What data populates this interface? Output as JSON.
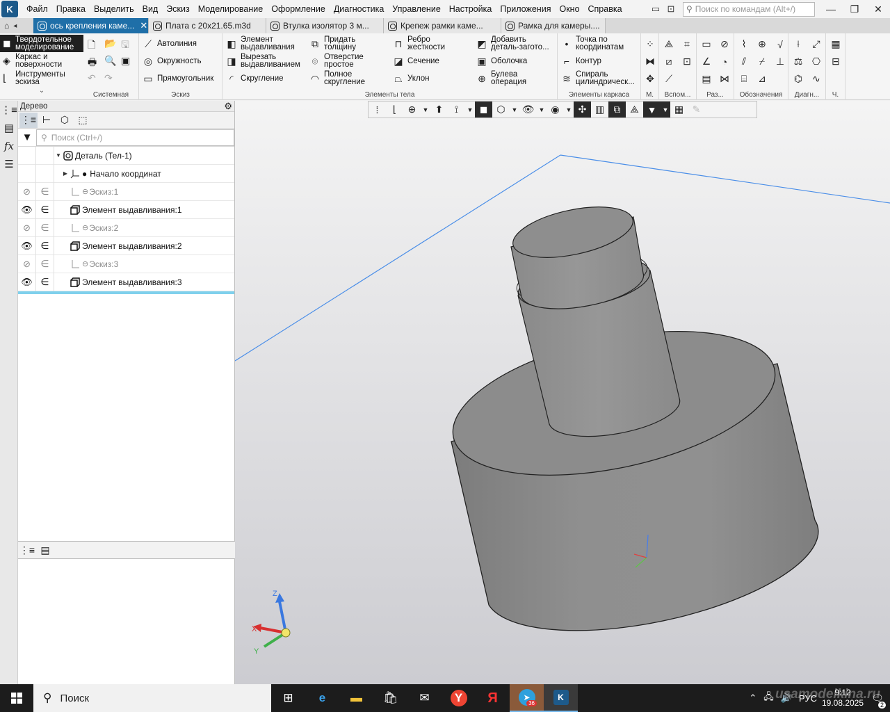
{
  "menu": {
    "items": [
      "Файл",
      "Правка",
      "Выделить",
      "Вид",
      "Эскиз",
      "Моделирование",
      "Оформление",
      "Диагностика",
      "Управление",
      "Настройка",
      "Приложения",
      "Окно",
      "Справка"
    ],
    "command_search_placeholder": "Поиск по командам (Alt+/)"
  },
  "tabs": [
    {
      "label": "ось крепления каме...",
      "active": true
    },
    {
      "label": "Плата с 20x21.65.m3d",
      "active": false
    },
    {
      "label": "Втулка изолятор 3 м...",
      "active": false
    },
    {
      "label": "Крепеж рамки каме...",
      "active": false
    },
    {
      "label": "Рамка для камеры....",
      "active": false
    }
  ],
  "ribbon": {
    "modes": [
      "Твердотельное\nмоделирование",
      "Каркас и\nповерхности",
      "Инструменты\nэскиза"
    ],
    "groups": {
      "system": "Системная",
      "sketch": "Эскиз",
      "body": "Элементы тела",
      "frame": "Элементы каркаса",
      "m": "М.",
      "aux": "Вспом...",
      "razm": "Раз...",
      "notes": "Обозначения",
      "diag": "Диагн...",
      "ch": "Ч."
    },
    "sketch_cmds": [
      "Автолиния",
      "Окружность",
      "Прямоугольник"
    ],
    "body_cmds": [
      "Элемент\nвыдавливания",
      "Придать\nтолщину",
      "Ребро\nжесткости",
      "Добавить\nдеталь-загото...",
      "Вырезать\nвыдавливанием",
      "Отверстие\nпростое",
      "Сечение",
      "Оболочка",
      "Скругление",
      "Полное\nскругление",
      "Уклон",
      "Булева\nоперация"
    ],
    "frame_cmds": [
      "Точка по\nкоординатам",
      "Контур",
      "Спираль\nцилиндрическ..."
    ]
  },
  "tree": {
    "title": "Дерево",
    "search_placeholder": "Поиск (Ctrl+/)",
    "root": "Деталь (Тел-1)",
    "origin": "Начало координат",
    "items": [
      {
        "label": "Эскиз:1",
        "kind": "sketch"
      },
      {
        "label": "Элемент выдавливания:1",
        "kind": "extrude"
      },
      {
        "label": "Эскиз:2",
        "kind": "sketch"
      },
      {
        "label": "Элемент выдавливания:2",
        "kind": "extrude"
      },
      {
        "label": "Эскиз:3",
        "kind": "sketch"
      },
      {
        "label": "Элемент выдавливания:3",
        "kind": "extrude"
      }
    ]
  },
  "axes": {
    "x": "X",
    "y": "Y",
    "z": "Z"
  },
  "taskbar": {
    "search_label": "Поиск",
    "telegram_badge": "36",
    "lang": "РУС",
    "time": "9:12",
    "date": "19.08.2025",
    "notifications": "2",
    "watermark": "usamodelkina.ru"
  },
  "colors": {
    "accent": "#1f6fa8",
    "selection": "#7fd0ec",
    "model": "#8a8a8a"
  }
}
